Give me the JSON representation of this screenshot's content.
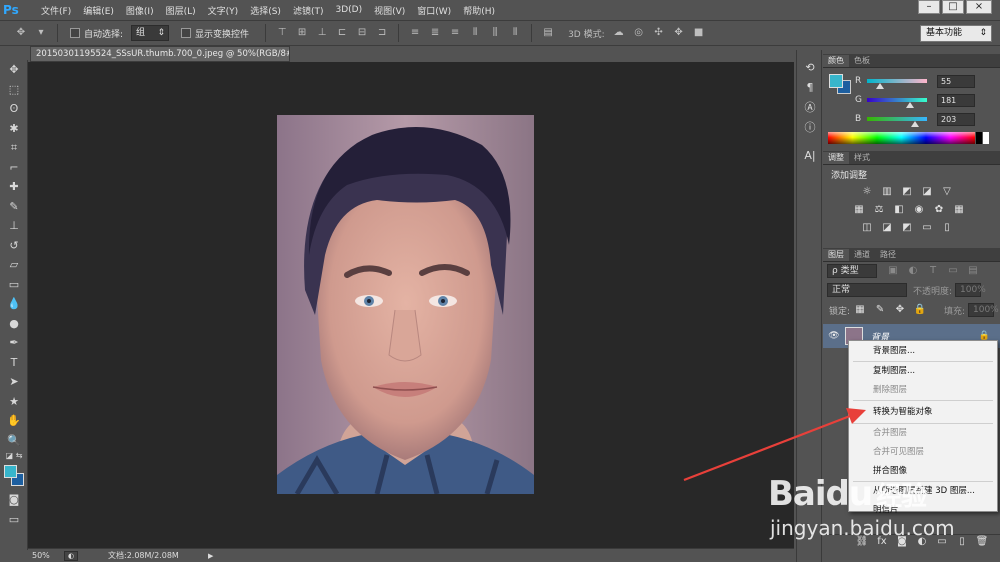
{
  "app": {
    "logo": "Ps",
    "menus": [
      "文件(F)",
      "编辑(E)",
      "图像(I)",
      "图层(L)",
      "文字(Y)",
      "选择(S)",
      "滤镜(T)",
      "3D(D)",
      "视图(V)",
      "窗口(W)",
      "帮助(H)"
    ],
    "window_controls": [
      "–",
      "□",
      "×"
    ]
  },
  "options": {
    "auto_select_label": "自动选择:",
    "auto_select_value": "组",
    "show_transform_label": "显示变换控件",
    "mode3d_label": "3D 模式:",
    "workspace": "基本功能"
  },
  "document": {
    "tab_title": "20150301195524_SSsUR.thumb.700_0.jpeg @ 50%(RGB/8#) *",
    "zoom": "50%",
    "doc_info": "文档:2.08M/2.08M"
  },
  "color_panel": {
    "tabs": [
      "颜色",
      "色板"
    ],
    "r_label": "R",
    "r_value": "55",
    "g_label": "G",
    "g_value": "181",
    "b_label": "B",
    "b_value": "203",
    "r": 55,
    "g": 181,
    "b": 203,
    "fg_color": "#37b5cb",
    "bg_color": "#1d5fa0"
  },
  "adjust_panel": {
    "tabs": [
      "调整",
      "样式"
    ],
    "title": "添加调整"
  },
  "layers_panel": {
    "tabs": [
      "图层",
      "通道",
      "路径"
    ],
    "filter_label": "类型",
    "blend_mode": "正常",
    "opacity_label": "不透明度:",
    "opacity_value": "100%",
    "lock_label": "锁定:",
    "fill_label": "填充:",
    "fill_value": "100%",
    "layer_name": "背景"
  },
  "context_menu": {
    "item_bg_layer": "背景图层...",
    "item_duplicate": "复制图层...",
    "item_delete": "删除图层",
    "item_convert_smart": "转换为智能对象",
    "item_merge": "合并图层",
    "item_merge_visible": "合并可见图层",
    "item_flatten": "拼合图像",
    "item_new3d": "从所选图层新建 3D 图层...",
    "item_postcard": "明信片"
  },
  "watermark": {
    "brand": "Baidu",
    "brand_suffix": "经验",
    "url": "jingyan.baidu.com"
  },
  "colors": {
    "accent_arrow": "#e8403a",
    "panel_bg": "#535353",
    "canvas_bg": "#282828"
  }
}
